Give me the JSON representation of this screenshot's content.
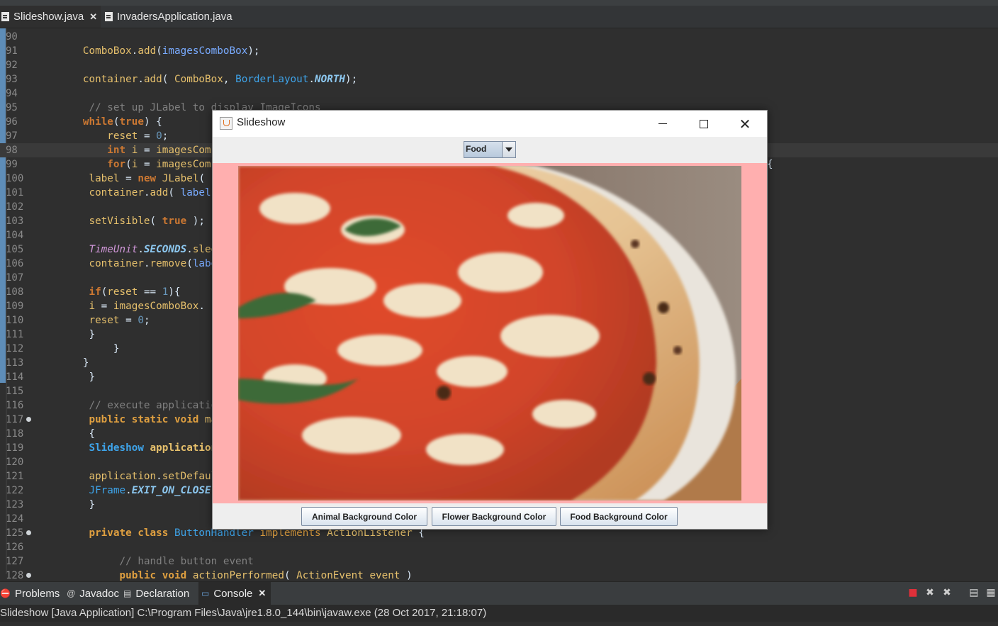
{
  "editor_tabs": [
    {
      "label": "Slideshow.java",
      "active": true
    },
    {
      "label": "InvadersApplication.java",
      "active": false
    }
  ],
  "code_lines": [
    {
      "n": "90",
      "html": ""
    },
    {
      "n": "91",
      "html": "        <span class=\"fn\">ComboBox</span>.<span class=\"fn\">add</span>(<span class=\"va\">imagesComboBox</span>);"
    },
    {
      "n": "92",
      "html": ""
    },
    {
      "n": "93",
      "html": "        <span class=\"fn\">container</span>.<span class=\"fn\">add</span>( <span class=\"fn\">ComboBox</span>, <span class=\"cl\" style=\"font-weight:normal\">BorderLayout</span>.<span class=\"sf\">NORTH</span>);"
    },
    {
      "n": "94",
      "html": ""
    },
    {
      "n": "95",
      "html": "         <span class=\"cm\">// set up JLabel to display ImageIcons</span>"
    },
    {
      "n": "96",
      "html": "        <span class=\"kw\">while</span>(<span class=\"kw\">true</span>) {"
    },
    {
      "n": "97",
      "html": "            <span class=\"fn\">reset</span> = <span class=\"nm\">0</span>;"
    },
    {
      "n": "98",
      "html": "            <span class=\"kw\">int</span> <span class=\"fn\">i</span> = <span class=\"fn\">imagesComboBox</span>",
      "current": true
    },
    {
      "n": "99",
      "html": "            <span class=\"kw\">for</span>(<span class=\"fn\">i</span> = <span class=\"fn\">imagesComboBox</span>"
    },
    {
      "n": "100",
      "html": "         <span class=\"fn\">label</span> = <span class=\"kw\">new</span> <span class=\"fn\">JLabel</span>("
    },
    {
      "n": "101",
      "html": "         <span class=\"fn\">container</span>.<span class=\"fn\">add</span>( <span class=\"va\">label</span>"
    },
    {
      "n": "102",
      "html": ""
    },
    {
      "n": "103",
      "html": "         <span class=\"fn\">setVisible</span>( <span class=\"kw\">true</span> );"
    },
    {
      "n": "104",
      "html": ""
    },
    {
      "n": "105",
      "html": "         <span class=\"it\">TimeUnit</span>.<span class=\"sf\">SECONDS</span>.<span class=\"fn\">sleep</span>"
    },
    {
      "n": "106",
      "html": "         <span class=\"fn\">container</span>.<span class=\"fn\">remove</span>(<span class=\"va\">label</span>"
    },
    {
      "n": "107",
      "html": ""
    },
    {
      "n": "108",
      "html": "         <span class=\"kw\">if</span>(<span class=\"fn\">reset</span> == <span class=\"nm\">1</span>){"
    },
    {
      "n": "109",
      "html": "         <span class=\"fn\">i</span> = <span class=\"fn\">imagesComboBox</span>."
    },
    {
      "n": "110",
      "html": "         <span class=\"fn\">reset</span> = <span class=\"nm\">0</span>;"
    },
    {
      "n": "111",
      "html": "         }"
    },
    {
      "n": "112",
      "html": "             }"
    },
    {
      "n": "113",
      "html": "        }"
    },
    {
      "n": "114",
      "html": "         }"
    },
    {
      "n": "115",
      "html": ""
    },
    {
      "n": "116",
      "html": "         <span class=\"cm\">// execute application</span>"
    },
    {
      "n": "117",
      "html": "         <span class=\"kwp\">public static void</span> <span class=\"fn\">main</span>",
      "fold": true
    },
    {
      "n": "118",
      "html": "         {"
    },
    {
      "n": "119",
      "html": "         <span class=\"cl\">Slideshow</span> <span class=\"fn\" style=\"font-weight:bold\">application</span>"
    },
    {
      "n": "120",
      "html": ""
    },
    {
      "n": "121",
      "html": "         <span class=\"fn\">application</span>.<span class=\"fn\">setDefaultCloseOperation</span>("
    },
    {
      "n": "122",
      "html": "         <span class=\"cl\" style=\"font-weight:normal\">JFrame</span>.<span class=\"sf\">EXIT_ON_CLOSE</span>"
    },
    {
      "n": "123",
      "html": "         }"
    },
    {
      "n": "124",
      "html": ""
    },
    {
      "n": "125",
      "html": "         <span class=\"kwp\">private class</span> <span class=\"cl\" style=\"font-weight:normal\">ButtonHandler</span> <span class=\"kwp\" style=\"font-weight:normal\">implements</span> <span class=\"fn\">ActionListener</span> {",
      "fold": true
    },
    {
      "n": "126",
      "html": ""
    },
    {
      "n": "127",
      "html": "              <span class=\"cm\">// handle button event</span>"
    },
    {
      "n": "128",
      "html": "              <span class=\"kwp\">public void</span> <span class=\"fn\">actionPerformed</span>( <span class=\"fn\">ActionEvent</span> <span class=\"fn\">event</span> )",
      "fold": true
    }
  ],
  "trailing_brace": "{",
  "bottom_tabs": [
    {
      "label": "Problems",
      "icon": "problems-icon",
      "glyph": "⛔"
    },
    {
      "label": "Javadoc",
      "icon": "javadoc-icon",
      "glyph": "@"
    },
    {
      "label": "Declaration",
      "icon": "declaration-icon",
      "glyph": "▤"
    },
    {
      "label": "Console",
      "icon": "console-icon",
      "glyph": "▭",
      "active": true
    }
  ],
  "console_text": "Slideshow [Java Application] C:\\Program Files\\Java\\jre1.8.0_144\\bin\\javaw.exe (28 Oct 2017, 21:18:07)",
  "window": {
    "title": "Slideshow",
    "combo_value": "Food",
    "buttons": [
      "Animal Background Color",
      "Flower Background Color",
      "Food Background Color"
    ],
    "panel_color": "#ffafaf",
    "image_subject": "pizza-photo"
  }
}
